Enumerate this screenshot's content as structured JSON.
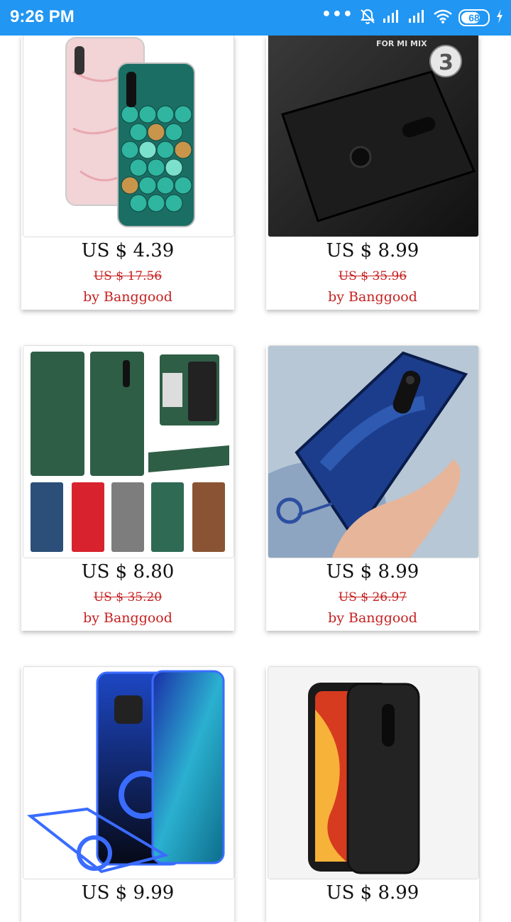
{
  "status_bar": {
    "time": "9:26 PM",
    "battery": "68"
  },
  "products": [
    {
      "price": "US $ 4.39",
      "old_price": "US $ 17.56",
      "seller": "by Banggood",
      "image": "marble-and-mermaid-scale-phone-cases"
    },
    {
      "price": "US $ 8.99",
      "old_price": "US $ 35.96",
      "seller": "by Banggood",
      "image": "black-fabric-case",
      "badge_text": "FOR MI MIX",
      "badge_number": "3"
    },
    {
      "price": "US $ 8.80",
      "old_price": "US $ 35.20",
      "seller": "by Banggood",
      "image": "leather-flip-wallet-cases"
    },
    {
      "price": "US $ 8.99",
      "old_price": "US $ 26.97",
      "seller": "by Banggood",
      "image": "blue-frameless-case-in-hand"
    },
    {
      "price": "US $ 9.99",
      "image": "clear-blue-case-with-ring"
    },
    {
      "price": "US $ 8.99",
      "image": "black-shockproof-case"
    }
  ]
}
